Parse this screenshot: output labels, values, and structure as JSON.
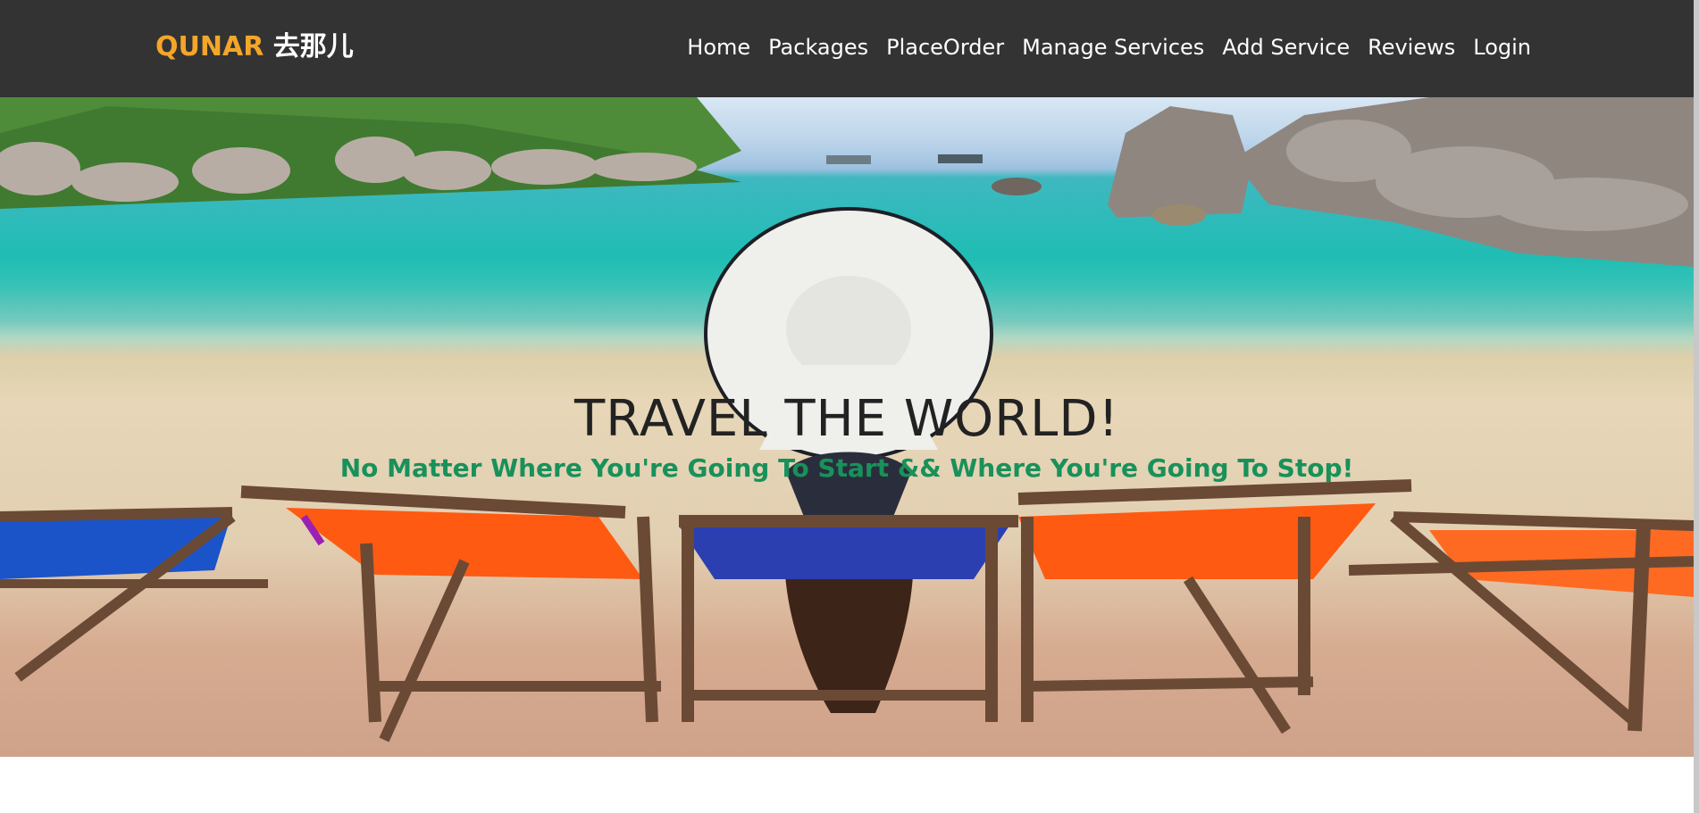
{
  "brand": {
    "name_en": "QUNAR",
    "name_cn": "去那儿",
    "accent_color": "#f4a62a"
  },
  "nav": {
    "items": [
      {
        "label": "Home"
      },
      {
        "label": "Packages"
      },
      {
        "label": "PlaceOrder"
      },
      {
        "label": "Manage Services"
      },
      {
        "label": "Add Service"
      },
      {
        "label": "Reviews"
      },
      {
        "label": "Login"
      }
    ]
  },
  "hero": {
    "title": "TRAVEL THE WORLD!",
    "subtitle": "No Matter Where You're Going To Start && Where You're Going To Stop!",
    "subtitle_color": "#18915a",
    "background_image": "beach-hero-image"
  },
  "colors": {
    "navbar_bg": "#333333"
  }
}
